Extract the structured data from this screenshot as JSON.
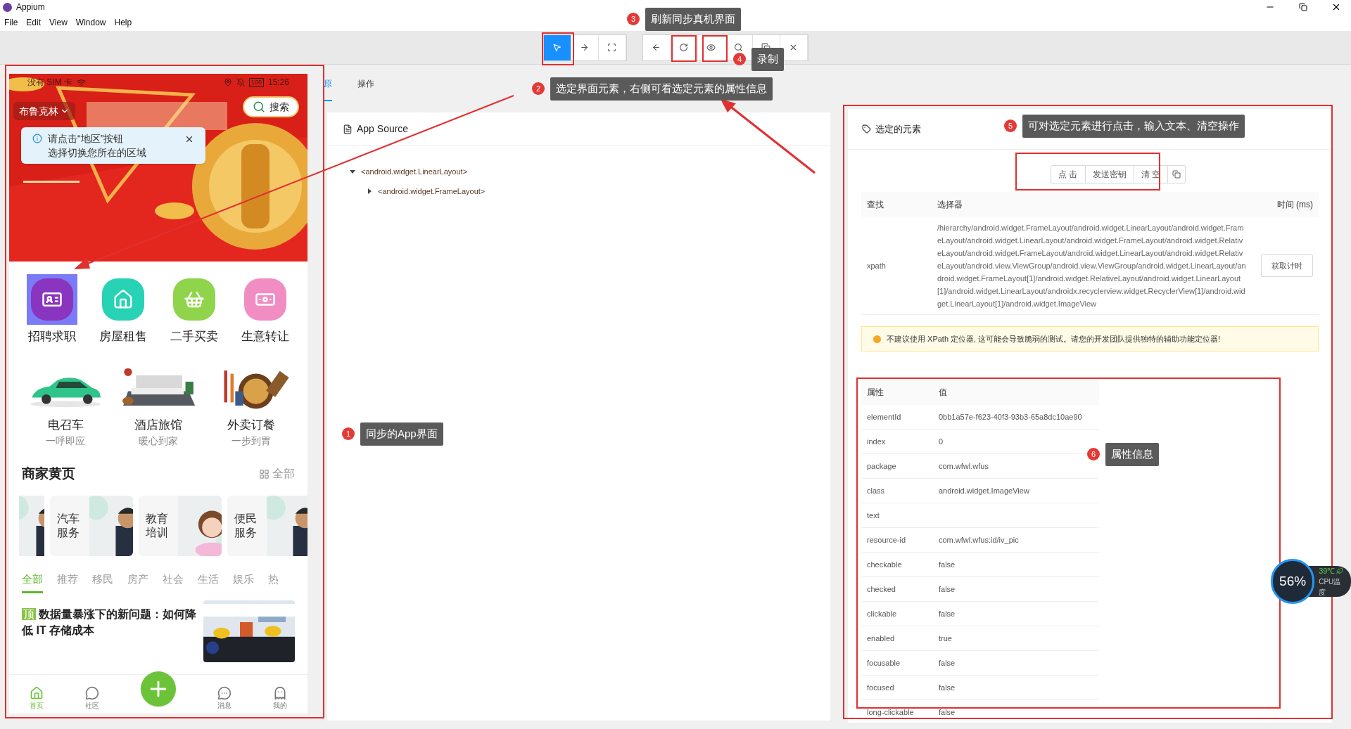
{
  "window": {
    "title": "Appium"
  },
  "menu": [
    {
      "label": "File"
    },
    {
      "label": "Edit"
    },
    {
      "label": "View"
    },
    {
      "label": "Window"
    },
    {
      "label": "Help"
    }
  ],
  "toolbar": {
    "groups": [
      {
        "buttons": [
          {
            "selected": true
          },
          {
            "selected": false
          },
          {
            "selected": false
          }
        ]
      },
      {
        "buttons": [
          {
            "selected": false
          },
          {
            "selected": false
          },
          {
            "selected": false
          },
          {
            "selected": false
          },
          {
            "selected": false
          },
          {
            "selected": false
          }
        ]
      }
    ]
  },
  "phone": {
    "status_bar": {
      "carrier": "没有 SIM 卡",
      "battery": "100",
      "time": "15:26"
    },
    "location": "布鲁克林",
    "search": "搜索",
    "tip": {
      "lines": [
        "请点击“地区”按钮",
        "选择切换您所在的区域"
      ]
    },
    "services": [
      {
        "label": "招聘求职",
        "color": "#8a35c0",
        "selected": true
      },
      {
        "label": "房屋租售",
        "color": "#27d3b4",
        "selected": false
      },
      {
        "label": "二手买卖",
        "color": "#8fd44a",
        "selected": false
      },
      {
        "label": "生意转让",
        "color": "#f28dc4",
        "selected": false
      }
    ],
    "features": [
      {
        "title": "电召车",
        "subtitle": "一呼即应"
      },
      {
        "title": "酒店旅馆",
        "subtitle": "暖心到家"
      },
      {
        "title": "外卖订餐",
        "subtitle": "一步到胃"
      }
    ],
    "directory": {
      "title": "商家黄页",
      "all": "全部",
      "cards": [
        {
          "label": "汽车服务"
        },
        {
          "label": "教育培训"
        },
        {
          "label": "便民服务"
        }
      ]
    },
    "categories": [
      {
        "label": "全部",
        "selected": true
      },
      {
        "label": "推荐",
        "selected": false
      },
      {
        "label": "移民",
        "selected": false
      },
      {
        "label": "房产",
        "selected": false
      },
      {
        "label": "社会",
        "selected": false
      },
      {
        "label": "生活",
        "selected": false
      },
      {
        "label": "娱乐",
        "selected": false
      },
      {
        "label": "热",
        "selected": false
      }
    ],
    "news": {
      "badge": "顶",
      "title": "数据量暴涨下的新问题：如何降低 IT 存储成本"
    },
    "nav": [
      {
        "kind": "tab",
        "label": "首页",
        "selected": true
      },
      {
        "kind": "tab",
        "label": "社区",
        "selected": false
      },
      {
        "kind": "add"
      },
      {
        "kind": "tab",
        "label": "消息",
        "selected": false
      },
      {
        "kind": "tab",
        "label": "我的",
        "selected": false
      }
    ]
  },
  "tabs": [
    {
      "label": "原",
      "selected": true
    },
    {
      "label": "操作",
      "selected": false
    }
  ],
  "source": {
    "title": "App Source",
    "tree": [
      {
        "label": "<android.widget.LinearLayout>",
        "expanded": true,
        "children": [
          {
            "label": "<android.widget.FrameLayout>",
            "expanded": false
          }
        ]
      }
    ]
  },
  "selected_element": {
    "title": "选定的元素",
    "actions": [
      {
        "label": "点 击"
      },
      {
        "label": "发送密钥"
      },
      {
        "label": "清 空"
      }
    ],
    "selector_table": {
      "columns": [
        "查找",
        "选择器",
        "时间 (ms)"
      ],
      "rows": [
        {
          "find": "xpath",
          "selector": "/hierarchy/android.widget.FrameLayout/android.widget.LinearLayout/android.widget.FrameLayout/android.widget.LinearLayout/android.widget.FrameLayout/android.widget.RelativeLayout/android.widget.FrameLayout/android.widget.LinearLayout/android.widget.RelativeLayout/android.view.ViewGroup/android.view.ViewGroup/android.widget.LinearLayout/android.widget.FrameLayout[1]/android.widget.RelativeLayout/android.widget.LinearLayout[1]/android.widget.LinearLayout/androidx.recyclerview.widget.RecyclerView[1]/android.widget.LinearLayout[1]/android.widget.ImageView",
          "button": "获取计时"
        }
      ]
    },
    "warning": "不建议使用 XPath 定位器, 这可能会导致脆弱的测试。请您的开发团队提供独特的辅助功能定位器!",
    "attributes": {
      "columns": [
        "属性",
        "值"
      ],
      "rows": [
        {
          "name": "elementId",
          "value": "0bb1a57e-f623-40f3-93b3-65a8dc10ae90"
        },
        {
          "name": "index",
          "value": "0"
        },
        {
          "name": "package",
          "value": "com.wfwl.wfus"
        },
        {
          "name": "class",
          "value": "android.widget.ImageView"
        },
        {
          "name": "text"
        },
        {
          "name": "resource-id",
          "value": "com.wfwl.wfus:id/iv_pic"
        },
        {
          "name": "checkable",
          "value": "false"
        },
        {
          "name": "checked",
          "value": "false"
        },
        {
          "name": "clickable",
          "value": "false"
        },
        {
          "name": "enabled",
          "value": "true"
        },
        {
          "name": "focusable",
          "value": "false"
        },
        {
          "name": "focused",
          "value": "false"
        },
        {
          "name": "long-clickable",
          "value": "false"
        }
      ]
    }
  },
  "annotations": [
    {
      "number": "3",
      "text": "刷新同步真机界面"
    },
    {
      "number": "4",
      "text": "录制"
    },
    {
      "number": "2",
      "text": "选定界面元素，右侧可看选定元素的属性信息"
    },
    {
      "number": "5",
      "text": "可对选定元素进行点击，输入文本、清空操作"
    },
    {
      "number": "1",
      "text": "同步的App界面"
    },
    {
      "number": "6",
      "text": "属性信息"
    }
  ],
  "cpu_monitor": {
    "usage": "56%",
    "temperature": "39℃",
    "label": "CPU温度"
  }
}
